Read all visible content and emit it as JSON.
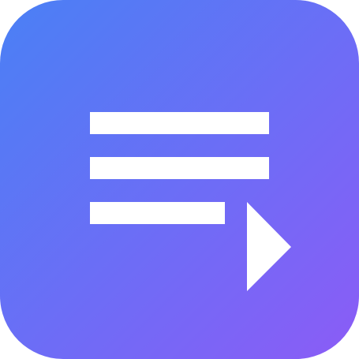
{
  "app_icon": {
    "icon": "playlist-play-icon",
    "gradient_start": "#4a80f5",
    "gradient_end": "#8b5cf6",
    "glyph_color": "#ffffff"
  }
}
